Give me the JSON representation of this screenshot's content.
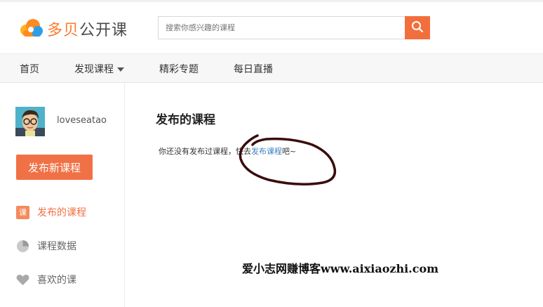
{
  "header": {
    "logo_brand": "多贝",
    "logo_suffix": "公开课",
    "search_placeholder": "搜索你感兴趣的课程",
    "search_button_icon": "search-icon",
    "accent_color": "#f26e3c"
  },
  "nav": {
    "items": [
      {
        "label": "首页"
      },
      {
        "label": "发现课程",
        "has_dropdown": true
      },
      {
        "label": "精彩专题"
      },
      {
        "label": "每日直播"
      }
    ]
  },
  "sidebar": {
    "username": "loveseatao",
    "publish_button": "发布新课程",
    "items": [
      {
        "label": "发布的课程",
        "icon": "course-icon",
        "active": true
      },
      {
        "label": "课程数据",
        "icon": "pie-chart-icon",
        "active": false
      },
      {
        "label": "喜欢的课",
        "icon": "heart-icon",
        "active": false
      }
    ]
  },
  "main": {
    "title": "发布的课程",
    "empty_prefix": "你还没有发布过课程，快去",
    "empty_link": "发布课程",
    "empty_suffix": "吧~"
  },
  "watermark": "爱小志网赚博客www.aixiaozhi.com"
}
